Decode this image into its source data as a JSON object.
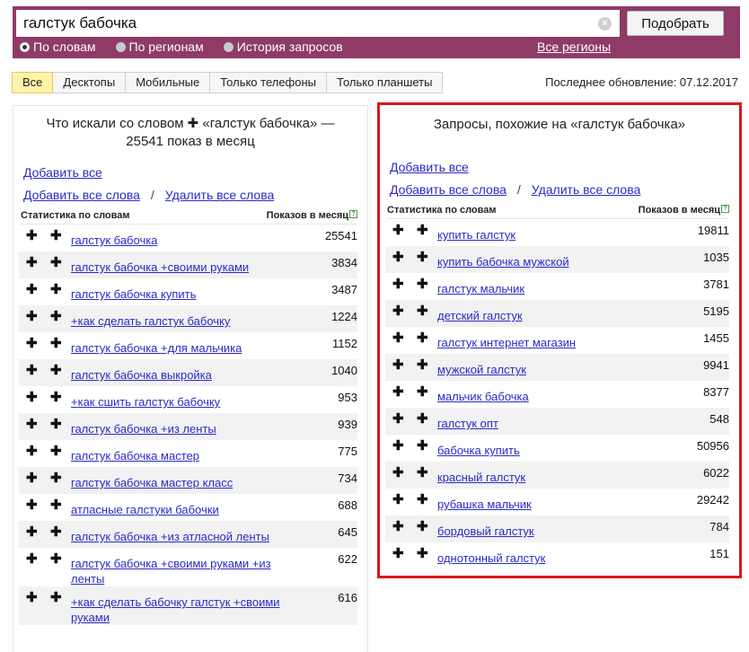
{
  "search": {
    "query": "галстук бабочка",
    "submit_label": "Подобрать",
    "modes": [
      "По словам",
      "По регионам",
      "История запросов"
    ],
    "all_regions": "Все регионы"
  },
  "tabs": [
    "Все",
    "Десктопы",
    "Мобильные",
    "Только телефоны",
    "Только планшеты"
  ],
  "last_update": "Последнее обновление: 07.12.2017",
  "left_panel": {
    "title": "Что искали со словом ✚ «галстук бабочка» — 25541 показ в месяц",
    "add_all": "Добавить все",
    "add_all_words": "Добавить все слова",
    "separator": "/",
    "remove_all_words": "Удалить все слова",
    "col_query": "Статистика по словам",
    "col_count": "Показов в месяц",
    "rows": [
      {
        "query": "галстук бабочка",
        "count": "25541"
      },
      {
        "query": "галстук бабочка +своими руками",
        "count": "3834"
      },
      {
        "query": "галстук бабочка купить",
        "count": "3487"
      },
      {
        "query": "+как сделать галстук бабочку",
        "count": "1224"
      },
      {
        "query": "галстук бабочка +для мальчика",
        "count": "1152"
      },
      {
        "query": "галстук бабочка выкройка",
        "count": "1040"
      },
      {
        "query": "+как сшить галстук бабочку",
        "count": "953"
      },
      {
        "query": "галстук бабочка +из ленты",
        "count": "939"
      },
      {
        "query": "галстук бабочка мастер",
        "count": "775"
      },
      {
        "query": "галстук бабочка мастер класс",
        "count": "734"
      },
      {
        "query": "атласные галстуки бабочки",
        "count": "688"
      },
      {
        "query": "галстук бабочка +из атласной ленты",
        "count": "645"
      },
      {
        "query": "галстук бабочка +своими руками +из ленты",
        "count": "622"
      },
      {
        "query": "+как сделать бабочку галстук +своими руками",
        "count": "616"
      }
    ]
  },
  "right_panel": {
    "title": "Запросы, похожие на «галстук бабочка»",
    "add_all": "Добавить все",
    "add_all_words": "Добавить все слова",
    "separator": "/",
    "remove_all_words": "Удалить все слова",
    "col_query": "Статистика по словам",
    "col_count": "Показов в месяц",
    "rows": [
      {
        "query": "купить галстук",
        "count": "19811"
      },
      {
        "query": "купить бабочка мужской",
        "count": "1035"
      },
      {
        "query": "галстук мальчик",
        "count": "3781"
      },
      {
        "query": "детский галстук",
        "count": "5195"
      },
      {
        "query": "галстук интернет магазин",
        "count": "1455"
      },
      {
        "query": "мужской галстук",
        "count": "9941"
      },
      {
        "query": "мальчик бабочка",
        "count": "8377"
      },
      {
        "query": "галстук опт",
        "count": "548"
      },
      {
        "query": "бабочка купить",
        "count": "50956"
      },
      {
        "query": "красный галстук",
        "count": "6022"
      },
      {
        "query": "рубашка мальчик",
        "count": "29242"
      },
      {
        "query": "бордовый галстук",
        "count": "784"
      },
      {
        "query": "однотонный галстук",
        "count": "151"
      }
    ]
  }
}
